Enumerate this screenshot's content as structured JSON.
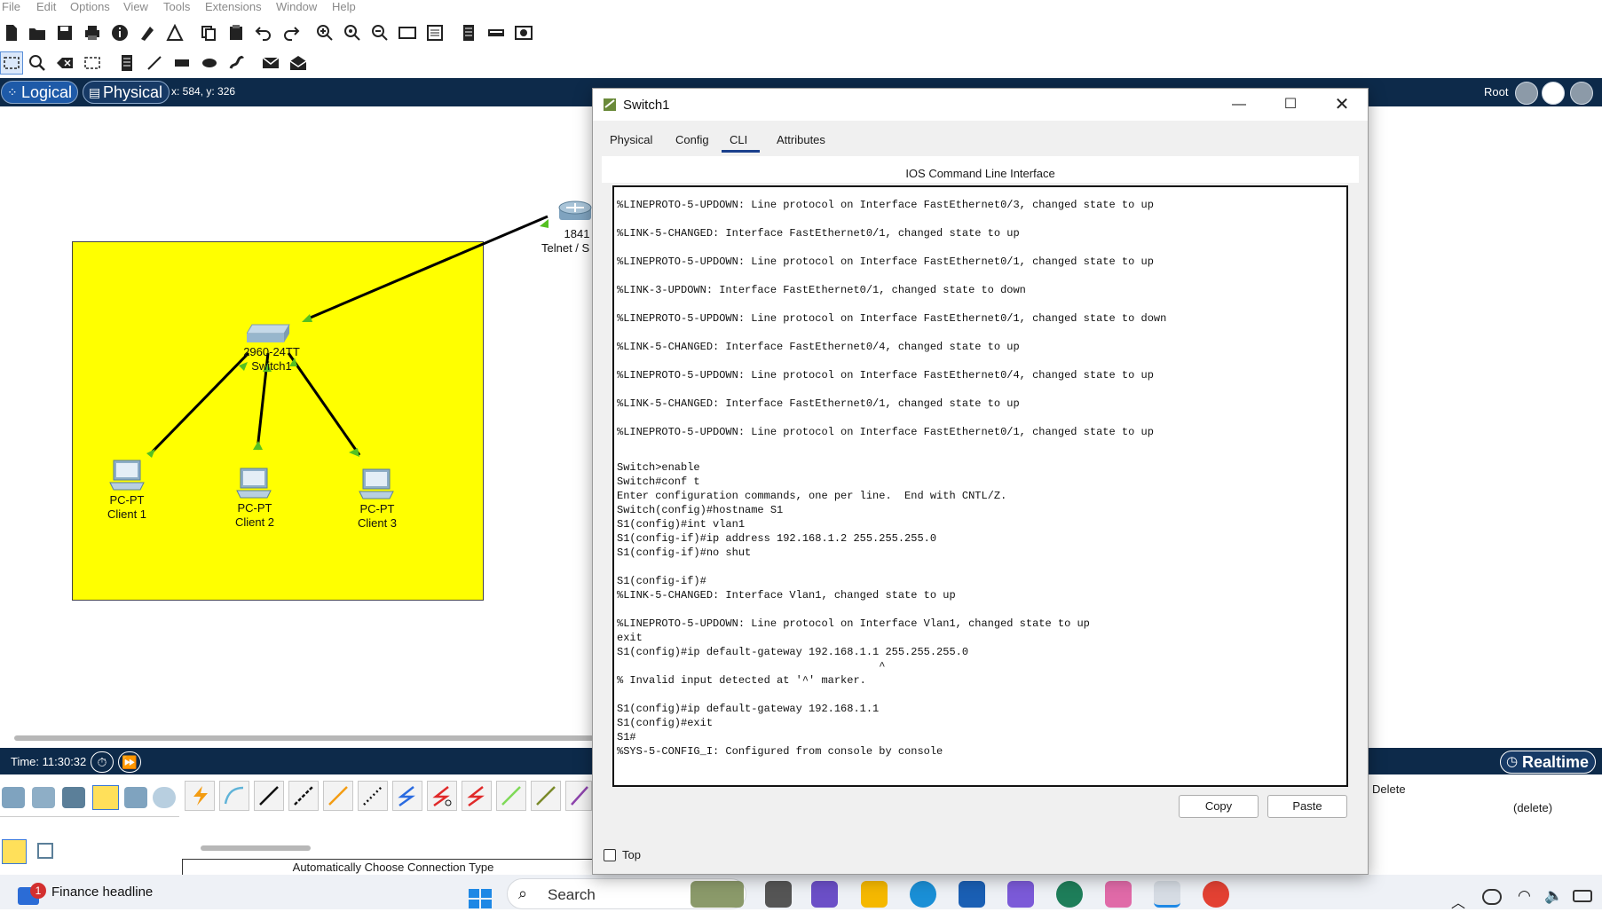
{
  "menu": [
    "File",
    "Edit",
    "Options",
    "View",
    "Tools",
    "Extensions",
    "Window",
    "Help"
  ],
  "workspace_bar": {
    "logical_label": "Logical",
    "physical_label": "Physical",
    "coords": "x: 584, y: 326",
    "root_label": "Root"
  },
  "topology": {
    "router": {
      "model": "1841",
      "name": "Telnet / S"
    },
    "switch": {
      "model": "2960-24TT",
      "name": "Switch1"
    },
    "pcs": [
      {
        "model": "PC-PT",
        "name": "Client 1"
      },
      {
        "model": "PC-PT",
        "name": "Client 2"
      },
      {
        "model": "PC-PT",
        "name": "Client 3"
      }
    ]
  },
  "timebar": {
    "time": "Time: 11:30:32",
    "realtime_label": "Realtime"
  },
  "bottom": {
    "connection_hint": "Automatically Choose Connection Type",
    "delete_header": "Delete",
    "delete_value": "(delete)"
  },
  "dialog": {
    "title": "Switch1",
    "tabs": [
      {
        "label": "Physical",
        "active": false
      },
      {
        "label": "Config",
        "active": false
      },
      {
        "label": "CLI",
        "active": true
      },
      {
        "label": "Attributes",
        "active": false
      }
    ],
    "cli_header": "IOS Command Line Interface",
    "copy_label": "Copy",
    "paste_label": "Paste",
    "top_label": "Top",
    "terminal_lines": [
      "%LINEPROTO-5-UPDOWN: Line protocol on Interface FastEthernet0/3, changed state to up",
      "",
      "%LINK-5-CHANGED: Interface FastEthernet0/1, changed state to up",
      "",
      "%LINEPROTO-5-UPDOWN: Line protocol on Interface FastEthernet0/1, changed state to up",
      "",
      "%LINK-3-UPDOWN: Interface FastEthernet0/1, changed state to down",
      "",
      "%LINEPROTO-5-UPDOWN: Line protocol on Interface FastEthernet0/1, changed state to down",
      "",
      "%LINK-5-CHANGED: Interface FastEthernet0/4, changed state to up",
      "",
      "%LINEPROTO-5-UPDOWN: Line protocol on Interface FastEthernet0/4, changed state to up",
      "",
      "%LINK-5-CHANGED: Interface FastEthernet0/1, changed state to up",
      "",
      "%LINEPROTO-5-UPDOWN: Line protocol on Interface FastEthernet0/1, changed state to up",
      "",
      "",
      "",
      "Switch>enable",
      "Switch#conf t",
      "Enter configuration commands, one per line.  End with CNTL/Z.",
      "Switch(config)#hostname S1",
      "S1(config)#int vlan1",
      "S1(config-if)#ip address 192.168.1.2 255.255.255.0",
      "S1(config-if)#no shut",
      "",
      "S1(config-if)#",
      "%LINK-5-CHANGED: Interface Vlan1, changed state to up",
      "",
      "%LINEPROTO-5-UPDOWN: Line protocol on Interface Vlan1, changed state to up",
      "exit",
      "S1(config)#ip default-gateway 192.168.1.1 255.255.255.0",
      "                                         ^",
      "% Invalid input detected at '^' marker.",
      "",
      "S1(config)#ip default-gateway 192.168.1.1",
      "S1(config)#exit",
      "S1#",
      "%SYS-5-CONFIG_I: Configured from console by console"
    ]
  },
  "taskbar": {
    "news_title": "Finance headline",
    "news_badge": "1",
    "search_placeholder": "Search"
  },
  "colors": {
    "workspace_bar": "#0d2a4a",
    "yellow_area": "#ffff00",
    "link_green": "#55c022"
  }
}
